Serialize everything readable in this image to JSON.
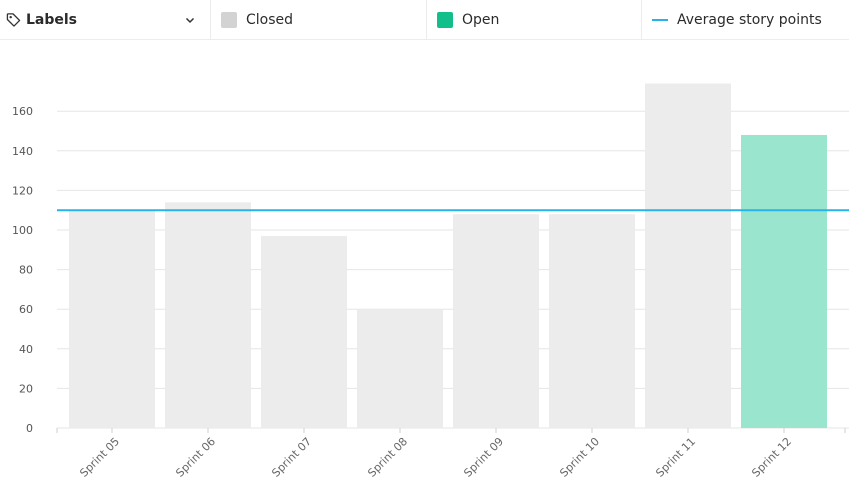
{
  "header": {
    "labels_dropdown": {
      "label": "Labels",
      "icon": "tag-icon",
      "chevron": "chevron-down-icon"
    },
    "legend": [
      {
        "key": "closed",
        "label": "Closed",
        "color": "#d3d3d3"
      },
      {
        "key": "open",
        "label": "Open",
        "color": "#12bf8a"
      },
      {
        "key": "avg",
        "label": "Average story points",
        "color": "#29b2e8"
      }
    ]
  },
  "chart_data": {
    "type": "bar",
    "categories": [
      "Sprint 05",
      "Sprint 06",
      "Sprint 07",
      "Sprint 08",
      "Sprint 09",
      "Sprint 10",
      "Sprint 11",
      "Sprint 12"
    ],
    "series": [
      {
        "name": "Closed",
        "values": [
          110,
          114,
          97,
          60,
          108,
          108,
          174,
          null
        ],
        "color": "#ececec"
      },
      {
        "name": "Open",
        "values": [
          null,
          null,
          null,
          null,
          null,
          null,
          null,
          148
        ],
        "color": "#9ae5cd"
      }
    ],
    "average": {
      "name": "Average story points",
      "value": 110,
      "color": "#29b2e8"
    },
    "ylim": [
      0,
      180
    ],
    "yticks": [
      0,
      20,
      40,
      60,
      80,
      100,
      120,
      140,
      160
    ],
    "grid": true
  }
}
